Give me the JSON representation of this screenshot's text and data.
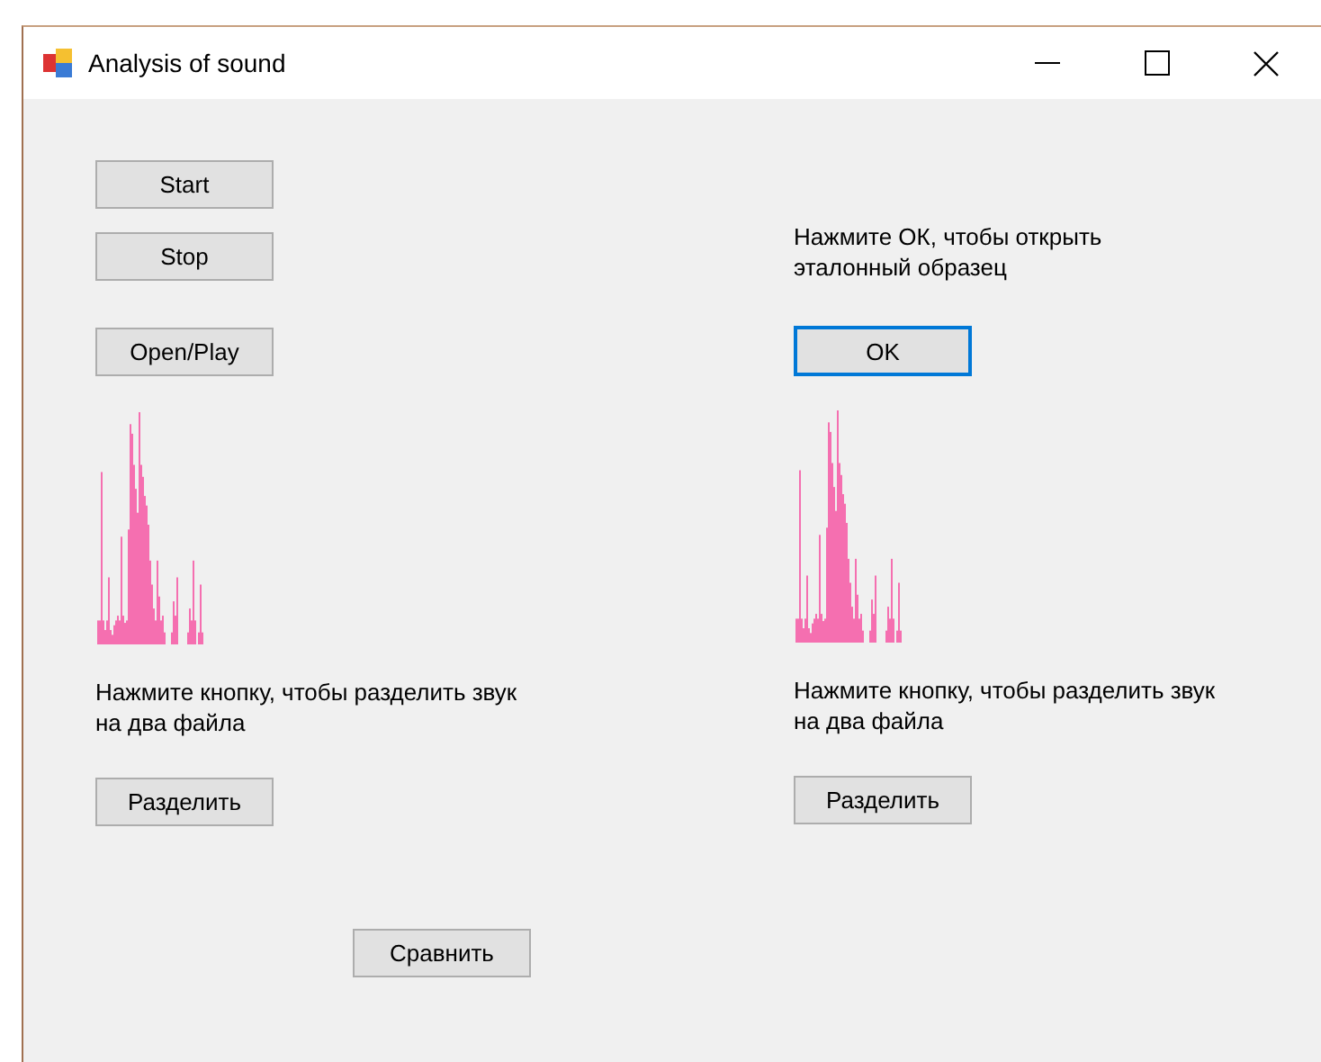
{
  "window": {
    "title": "Analysis of sound"
  },
  "left": {
    "buttons": [
      {
        "label": "Start",
        "focused": false
      },
      {
        "label": "Stop",
        "focused": false
      },
      {
        "label": "Open/Play",
        "focused": false
      }
    ],
    "hint": "Нажмите кнопку, чтобы разделить звук на два файла",
    "split_button": {
      "label": "Разделить",
      "focused": false
    }
  },
  "right": {
    "hint": "Нажмите ОК, чтобы открыть эталонный образец",
    "ok_button": {
      "label": "OK",
      "focused": true
    },
    "split_hint": "Нажмите кнопку, чтобы разделить звук на два файла",
    "split_button": {
      "label": "Разделить",
      "focused": false
    }
  },
  "compare_button": {
    "label": "Сравнить",
    "focused": false
  }
}
